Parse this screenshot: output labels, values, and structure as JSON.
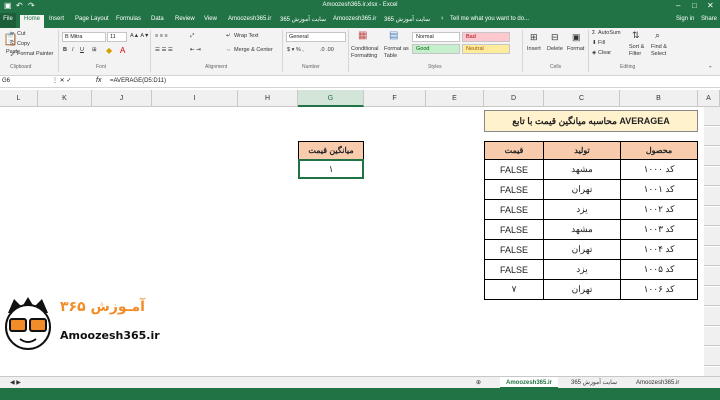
{
  "window": {
    "title": "Amoozesh365.ir.xlsx - Excel"
  },
  "ribbon_tabs": [
    "File",
    "Home",
    "Insert",
    "Page Layout",
    "Formulas",
    "Data",
    "Review",
    "View",
    "Amoozesh365.ir",
    "سایت آموزش 365",
    "Amoozesh365.ir",
    "سایت آموزش 365"
  ],
  "tell_me": "Tell me what you want to do...",
  "account": {
    "sign_in": "Sign in",
    "share": "Share"
  },
  "clipboard": {
    "cut": "Cut",
    "copy": "Copy",
    "format_painter": "Format Painter",
    "label": "Clipboard"
  },
  "font": {
    "name": "B Mitra",
    "size": "11",
    "label": "Font"
  },
  "alignment": {
    "wrap": "Wrap Text",
    "merge": "Merge & Center",
    "label": "Alignment"
  },
  "number": {
    "format": "General",
    "label": "Number"
  },
  "styles": {
    "conditional": "Conditional Formatting",
    "format_table": "Format as Table",
    "normal": "Normal",
    "bad": "Bad",
    "good": "Good",
    "neutral": "Neutral",
    "label": "Styles"
  },
  "cells": {
    "insert": "Insert",
    "delete": "Delete",
    "format": "Format",
    "label": "Cells"
  },
  "editing": {
    "autosum": "AutoSum",
    "fill": "Fill",
    "clear": "Clear",
    "sort": "Sort & Filter",
    "find": "Find & Select",
    "label": "Editing"
  },
  "formula_bar": {
    "cell_ref": "G6",
    "formula": "=AVERAGE(D5:D11)"
  },
  "columns": [
    "L",
    "K",
    "J",
    "I",
    "H",
    "G",
    "F",
    "E",
    "D",
    "C",
    "B",
    "A"
  ],
  "sheet": {
    "title": "محاسبه میانگین قیمت با تابع AVERAGEA",
    "headers": [
      "قیمت",
      "تولید",
      "محصول"
    ],
    "rows": [
      [
        "FALSE",
        "مشهد",
        "کد ۱۰۰۰"
      ],
      [
        "FALSE",
        "تهران",
        "کد ۱۰۰۱"
      ],
      [
        "FALSE",
        "یزد",
        "کد ۱۰۰۲"
      ],
      [
        "FALSE",
        "مشهد",
        "کد ۱۰۰۳"
      ],
      [
        "FALSE",
        "تهران",
        "کد ۱۰۰۴"
      ],
      [
        "FALSE",
        "یزد",
        "کد ۱۰۰۵"
      ],
      [
        "۷",
        "تهران",
        "کد ۱۰۰۶"
      ]
    ],
    "avg_header": "میانگین قیمت",
    "avg_value": "۱"
  },
  "logo": {
    "text": "Amoozesh365.ir",
    "persian": "آمـوزش ۳۶۵"
  },
  "sheet_tabs": [
    "Amoozesh365.ir",
    "سایت آموزش 365",
    "Amoozesh365.ir"
  ],
  "colors": {
    "excel_green": "#217346",
    "header_fill": "#f8cbad",
    "title_fill": "#fff2cc",
    "logo_orange": "#f28c28"
  }
}
